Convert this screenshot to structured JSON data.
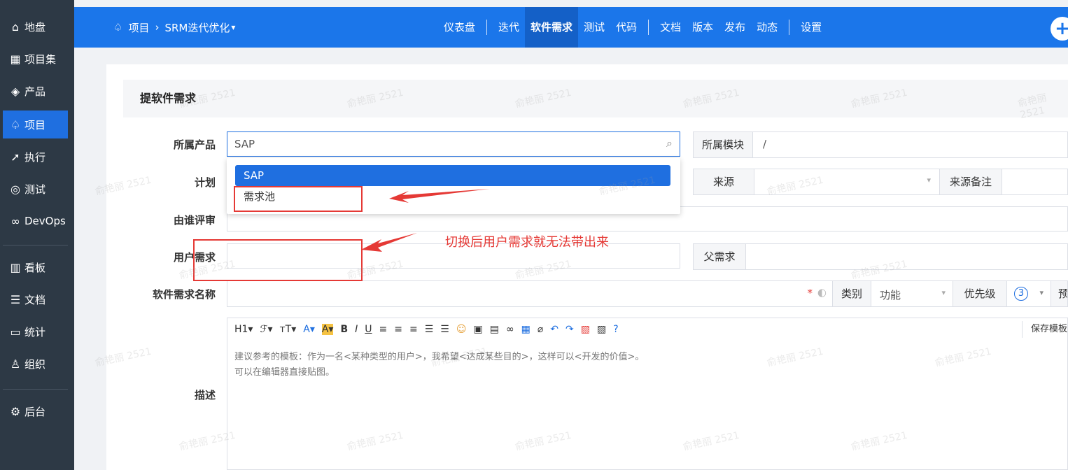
{
  "sidebar": {
    "items": [
      {
        "icon": "home-icon",
        "glyph": "⌂",
        "label": "地盘"
      },
      {
        "icon": "grid-icon",
        "glyph": "▦",
        "label": "项目集"
      },
      {
        "icon": "bulb-icon",
        "glyph": "◈",
        "label": "产品"
      },
      {
        "icon": "rocket-icon",
        "glyph": "♤",
        "label": "项目"
      },
      {
        "icon": "run-icon",
        "glyph": "➚",
        "label": "执行"
      },
      {
        "icon": "search-icon",
        "glyph": "◎",
        "label": "测试"
      },
      {
        "icon": "infinity-icon",
        "glyph": "∞",
        "label": "DevOps"
      },
      {
        "icon": "kanban-icon",
        "glyph": "▥",
        "label": "看板"
      },
      {
        "icon": "doc-icon",
        "glyph": "☰",
        "label": "文档"
      },
      {
        "icon": "chart-icon",
        "glyph": "▭",
        "label": "统计"
      },
      {
        "icon": "org-icon",
        "glyph": "♙",
        "label": "组织"
      },
      {
        "icon": "settings-icon",
        "glyph": "⚙",
        "label": "后台"
      }
    ],
    "active_index": 3
  },
  "topbar": {
    "breadcrumb_icon": "♤",
    "project": "项目",
    "separator": "›",
    "current": "SRM迭代优化",
    "caret": "▾",
    "nav": [
      "仪表盘",
      "迭代",
      "软件需求",
      "测试",
      "代码",
      "文档",
      "版本",
      "发布",
      "动态",
      "设置"
    ],
    "active_nav": "软件需求",
    "plus": "+"
  },
  "form": {
    "title": "提软件需求",
    "labels": {
      "product": "所属产品",
      "plan": "计划",
      "reviewer": "由谁评审",
      "user_req": "用户需求",
      "name": "软件需求名称",
      "desc": "描述"
    },
    "product_value": "SAP",
    "module_label": "所属模块",
    "module_value": "/",
    "source_label": "来源",
    "source_note_label": "来源备注",
    "parent_label": "父需求",
    "category_label": "类别",
    "category_value": "功能",
    "priority_label": "优先级",
    "priority_value": "3",
    "estimate_label_partial": "预",
    "required_mark": "*",
    "dropdown_options": [
      "SAP",
      "需求池"
    ]
  },
  "annotation": "切换后用户需求就无法带出来",
  "editor": {
    "toolbar": [
      "H1▾",
      "ℱ▾",
      "ᴛT▾",
      "A▾",
      "A▾",
      "B",
      "I",
      "U",
      "≡",
      "≡",
      "≡",
      "☰",
      "☰",
      "☺",
      "▣",
      "▤",
      "∞",
      "▦",
      "⌀",
      "↶",
      "↷",
      "▧",
      "▨",
      "?"
    ],
    "save_template": "保存模板",
    "hint_line1": "建议参考的模板：作为一名<某种类型的用户>，我希望<达成某些目的>，这样可以<开发的价值>。",
    "hint_line2": "可以在编辑器直接贴图。"
  },
  "watermark": "俞艳丽 2521"
}
